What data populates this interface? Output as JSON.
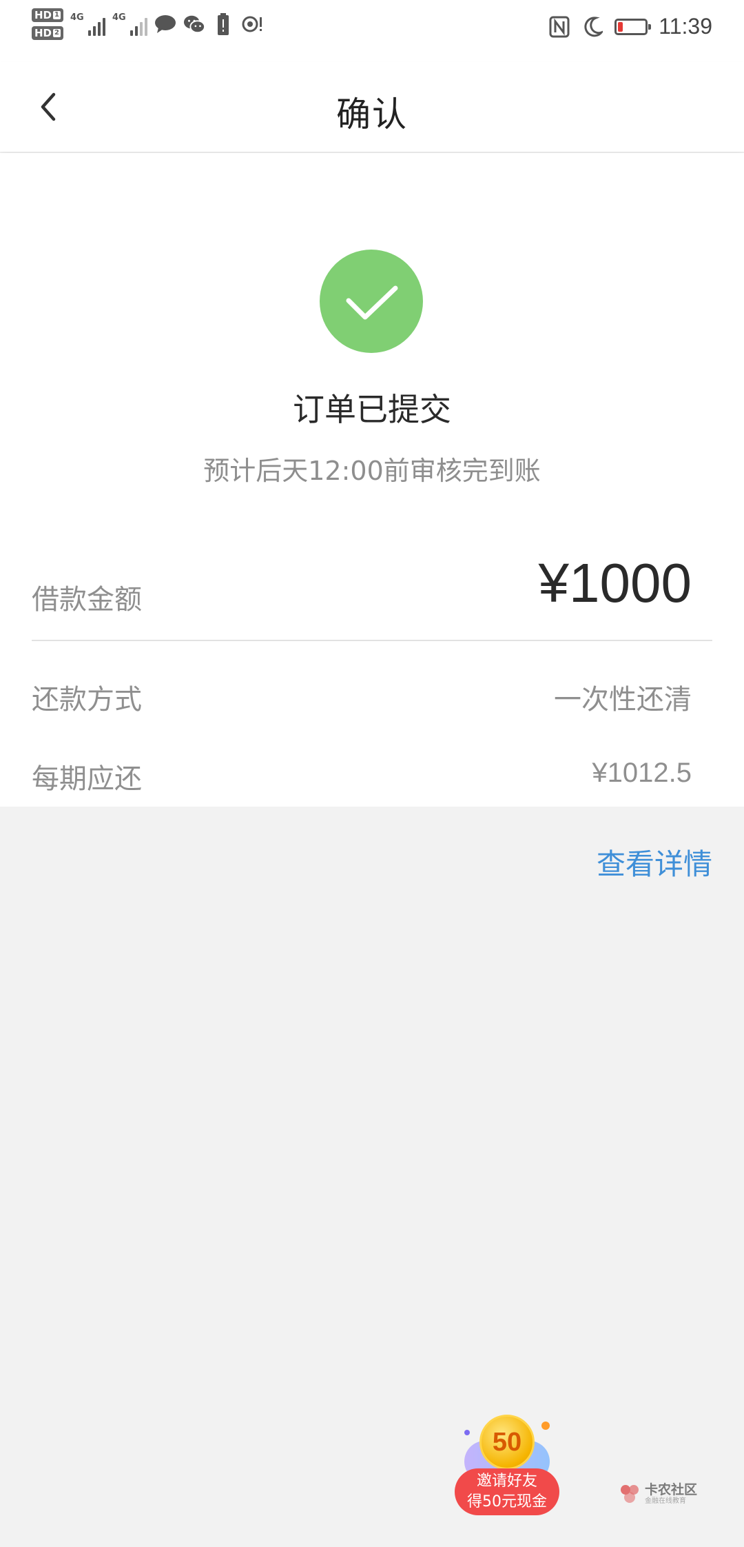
{
  "status_bar": {
    "hd1": "HD",
    "hd1_sub": "1",
    "hd2": "HD",
    "hd2_sub": "2",
    "net1": "4G",
    "net2": "4G",
    "time": "11:39",
    "battery_level": 0.15,
    "icons": [
      "message-icon",
      "wechat-icon",
      "battery-alert-icon",
      "hotspot-icon",
      "nfc-icon",
      "moon-icon"
    ]
  },
  "nav": {
    "back_icon": "chevron-left-icon",
    "title": "确认"
  },
  "status": {
    "icon": "checkmark-circle-icon",
    "title": "订单已提交",
    "subtitle": "预计后天12:00前审核完到账"
  },
  "details": {
    "amount_label": "借款金额",
    "amount_value": "¥1000",
    "method_label": "还款方式",
    "method_value": "一次性还清",
    "period_label": "每期应还",
    "period_value": "¥1012.5"
  },
  "view_details": "查看详情",
  "promo": {
    "coin": "50",
    "line1": "邀请好友",
    "line2": "得50元现金"
  },
  "watermark": {
    "name": "卡农社区",
    "tagline": "金融在线教育"
  },
  "colors": {
    "accent_green": "#80cf73",
    "link_blue": "#3f8fd8",
    "promo_red": "#f14a4a"
  }
}
